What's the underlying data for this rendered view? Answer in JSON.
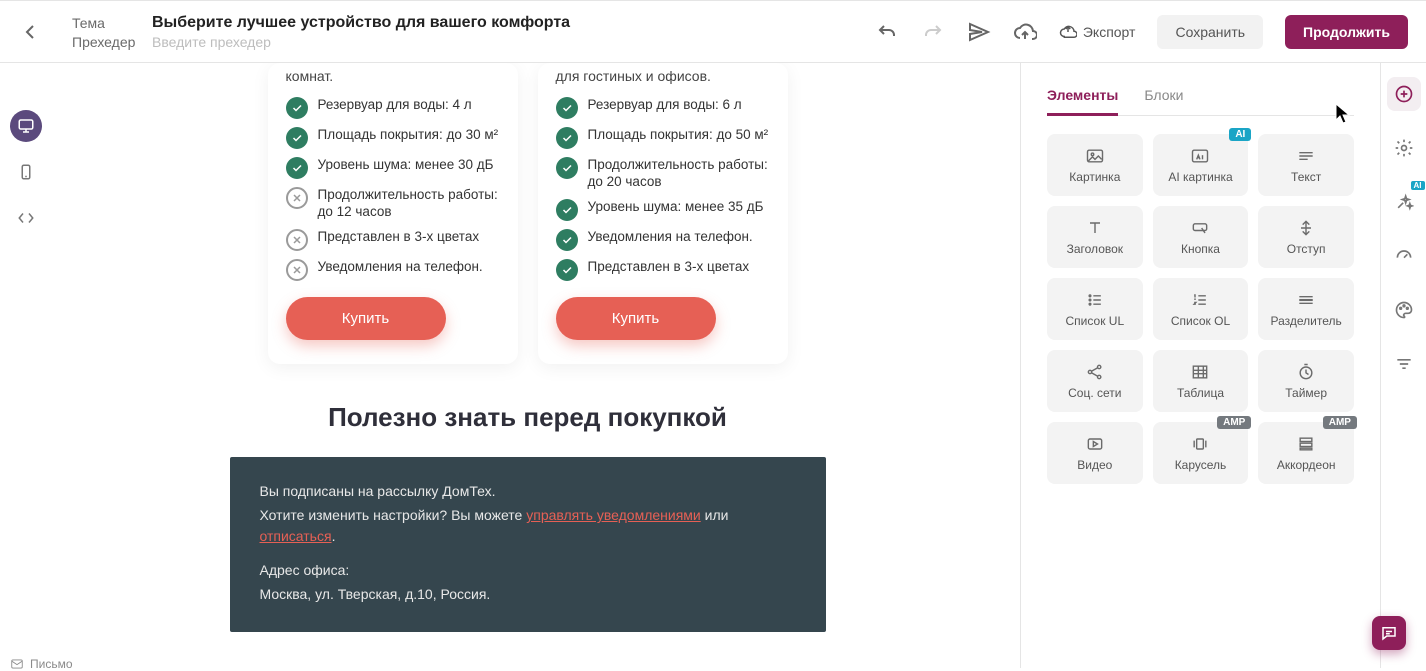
{
  "header": {
    "subject_label": "Тема",
    "subject_value": "Выберите лучшее устройство для вашего комфорта",
    "preheader_label": "Прехедер",
    "preheader_placeholder": "Введите прехедер",
    "export": "Экспорт",
    "save": "Сохранить",
    "continue": "Продолжить"
  },
  "card1": {
    "desc": "комнат.",
    "f1": "Резервуар для воды: 4 л",
    "f2": "Площадь покрытия: до 30 м²",
    "f3": "Уровень шума: менее 30 дБ",
    "f4": "Продолжительность работы: до 12 часов",
    "f5": "Представлен в 3-х цветах",
    "f6": "Уведомления на телефон.",
    "buy": "Купить"
  },
  "card2": {
    "desc": "для гостиных и офисов.",
    "f1": "Резервуар для воды: 6 л",
    "f2": "Площадь покрытия: до 50 м²",
    "f3": "Продолжительность работы: до 20 часов",
    "f4": "Уровень шума: менее 35 дБ",
    "f5": "Уведомления на телефон.",
    "f6": "Представлен в 3-х цветах",
    "buy": "Купить"
  },
  "section_title": "Полезно знать перед покупкой",
  "footer": {
    "l1": "Вы подписаны на рассылку ДомТех.",
    "l2a": "Хотите изменить настройки? Вы можете ",
    "link1": "управлять уведомлениями",
    "l2b": " или ",
    "link2": "отписаться",
    "l2c": ".",
    "addr_lbl": "Адрес офиса:",
    "addr": "Москва, ул. Тверская, д.10, Россия."
  },
  "sidebar": {
    "tab_elements": "Элементы",
    "tab_blocks": "Блоки",
    "tiles": {
      "image": "Картинка",
      "ai_image": "AI картинка",
      "text": "Текст",
      "heading": "Заголовок",
      "button": "Кнопка",
      "spacer": "Отступ",
      "ul": "Список UL",
      "ol": "Список OL",
      "divider": "Разделитель",
      "social": "Соц. сети",
      "table": "Таблица",
      "timer": "Таймер",
      "video": "Видео",
      "carousel": "Карусель",
      "accordion": "Аккордеон"
    },
    "badges": {
      "ai": "AI",
      "amp": "AMP"
    }
  },
  "bottom": {
    "hint": "Письмо"
  }
}
